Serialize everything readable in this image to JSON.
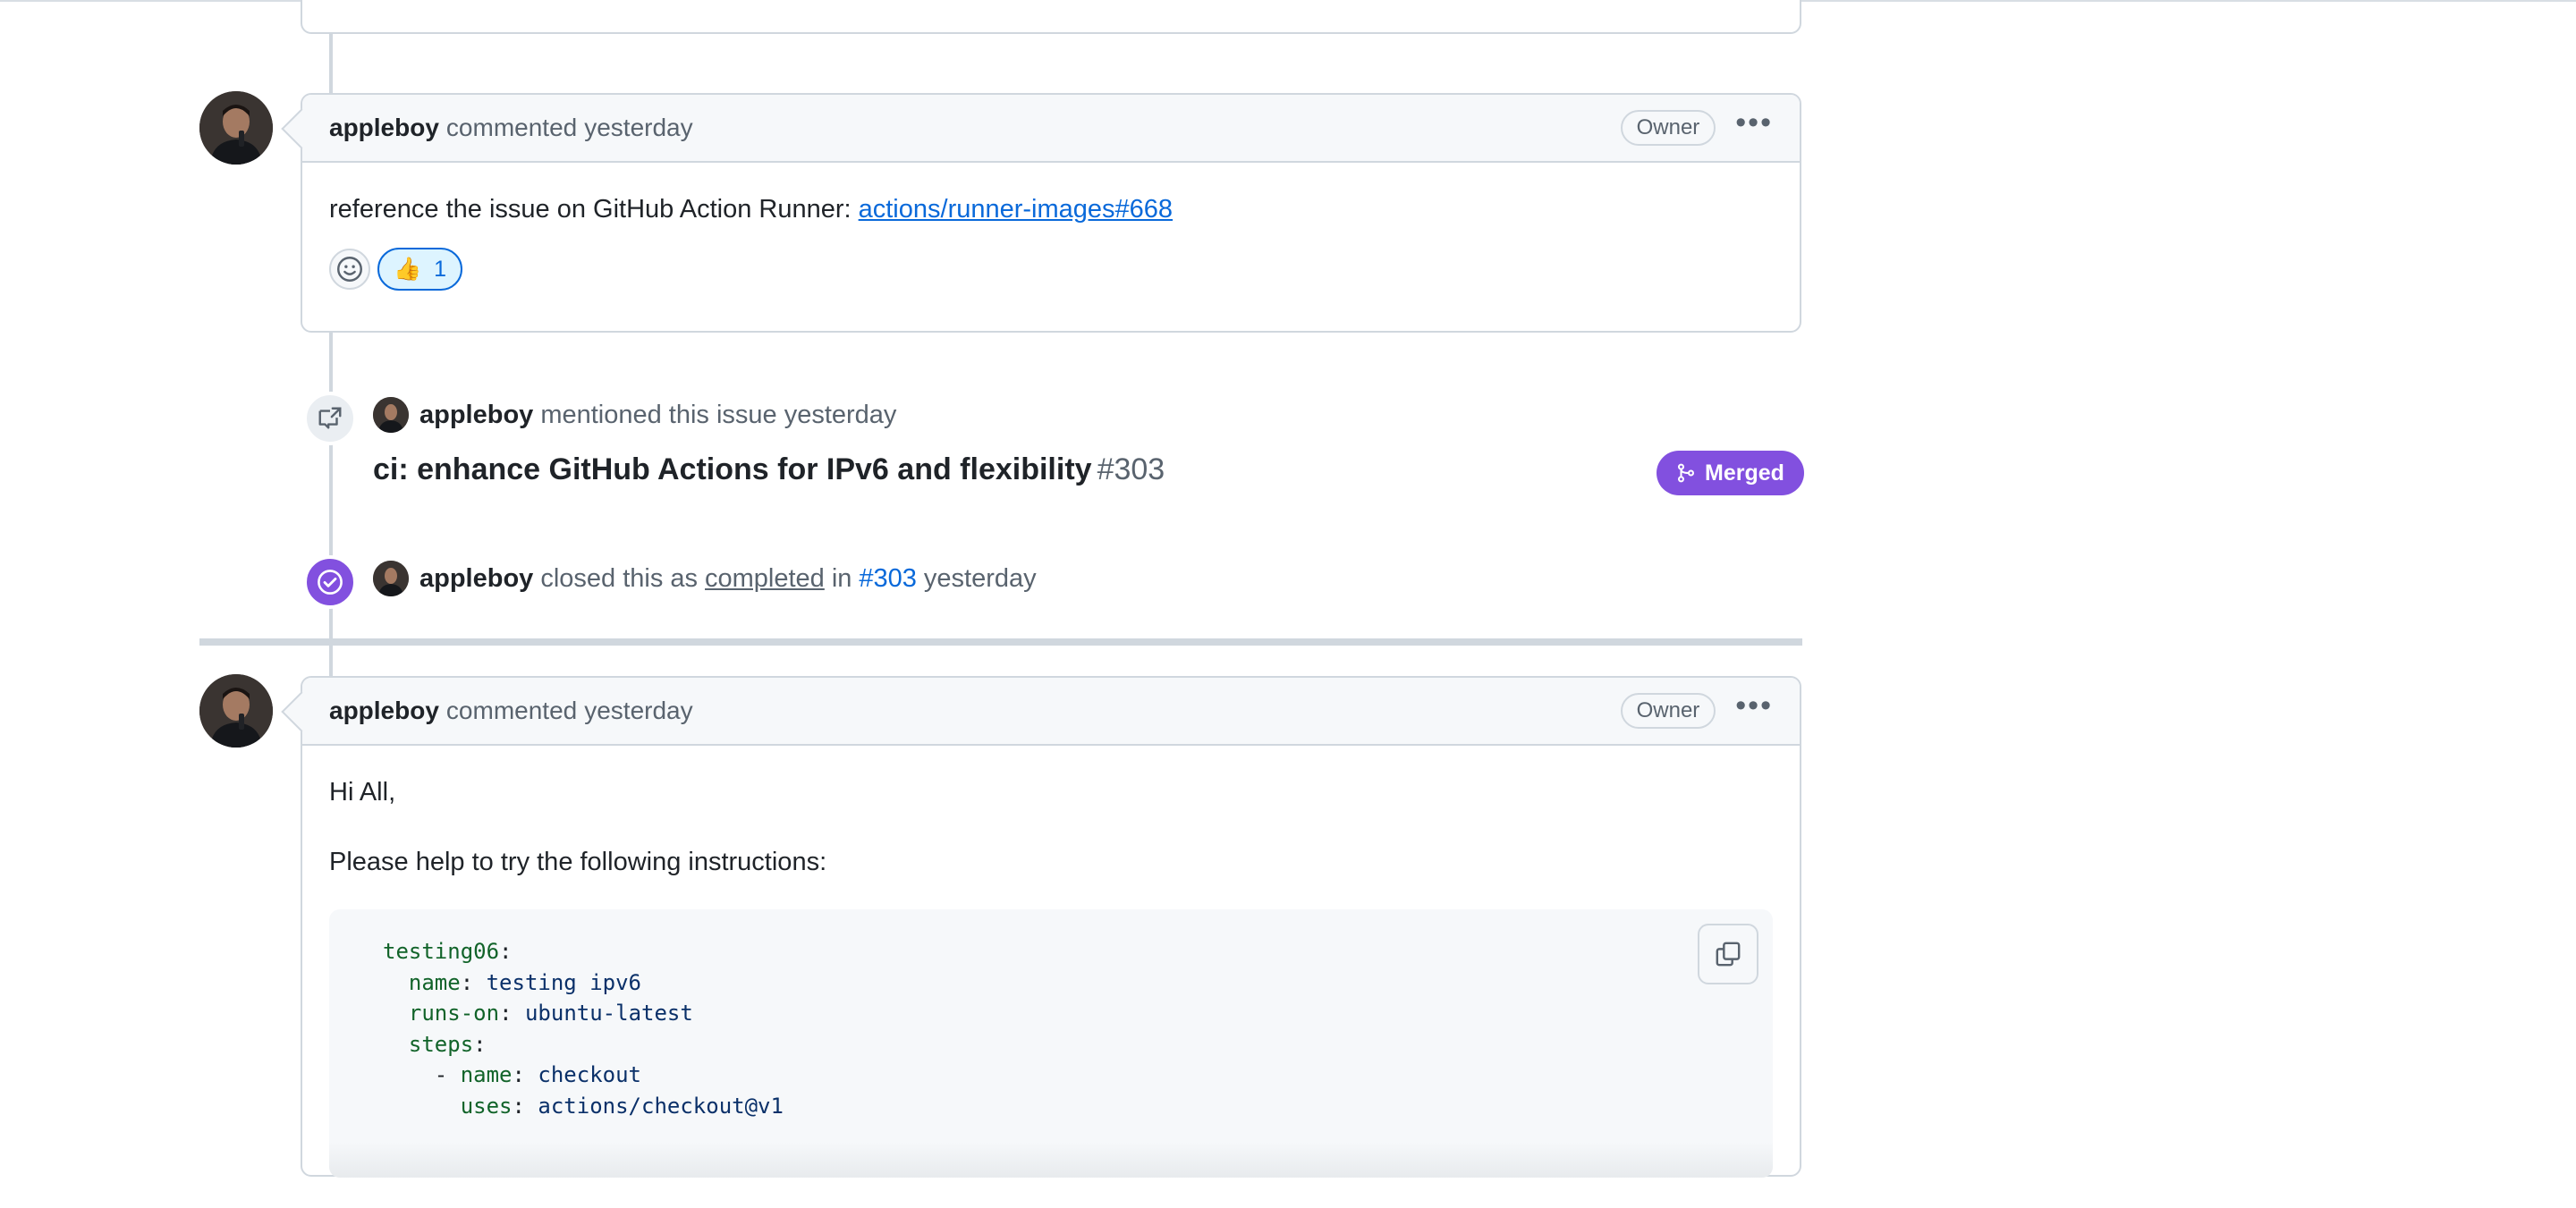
{
  "comments": [
    {
      "author": "appleboy",
      "action": "commented",
      "time": "yesterday",
      "badge": "Owner",
      "body_text": "reference the issue on GitHub Action Runner: ",
      "body_link": "actions/runner-images#668",
      "reaction_emoji": "👍",
      "reaction_count": "1"
    },
    {
      "author": "appleboy",
      "action": "commented",
      "time": "yesterday",
      "badge": "Owner",
      "greeting": "Hi All,",
      "intro": "Please help to try the following instructions:",
      "code": {
        "l1_key": "testing06",
        "l2_key": "name",
        "l2_val": "testing ipv6",
        "l3_key": "runs-on",
        "l3_val": "ubuntu-latest",
        "l4_key": "steps",
        "l5_dash": "- ",
        "l5_key": "name",
        "l5_val": "checkout",
        "l6_key": "uses",
        "l6_val": "actions/checkout@v1"
      }
    }
  ],
  "mention_event": {
    "author": "appleboy",
    "text": "mentioned this issue",
    "time": "yesterday",
    "pr_title": "ci: enhance GitHub Actions for IPv6 and flexibility",
    "pr_number": "#303",
    "status": "Merged",
    "status_color": "#8250df"
  },
  "close_event": {
    "author": "appleboy",
    "text_before": "closed this as",
    "reason": "completed",
    "text_in": "in",
    "pr_ref": "#303",
    "time": "yesterday"
  },
  "icons": [
    "smiley-icon",
    "cross-reference-icon",
    "check-circle-icon",
    "git-merge-icon",
    "copy-icon",
    "kebab-horizontal-icon"
  ]
}
